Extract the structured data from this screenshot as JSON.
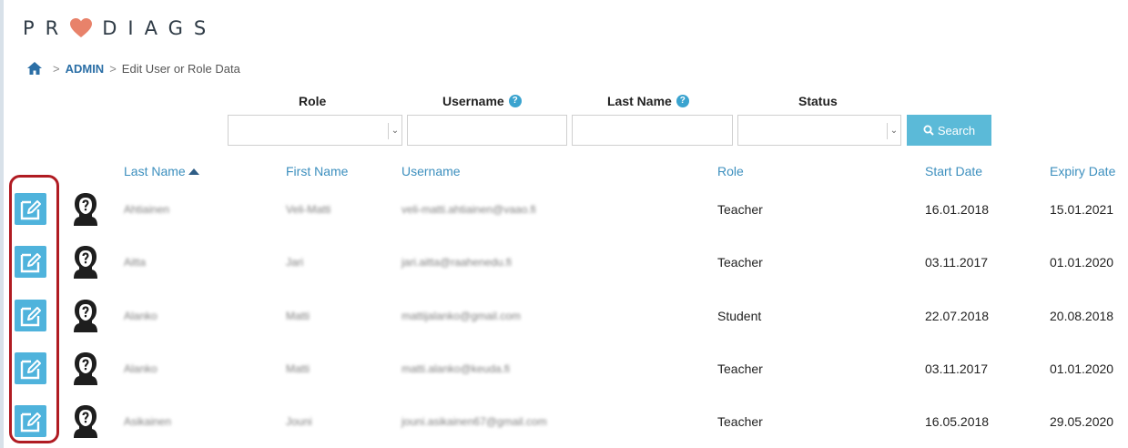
{
  "logo": {
    "text_a": "PR",
    "text_b": "DIAGS"
  },
  "breadcrumb": {
    "separator": ">",
    "admin": "ADMIN",
    "current": "Edit User or Role Data"
  },
  "filters": {
    "role_label": "Role",
    "username_label": "Username",
    "lastname_label": "Last Name",
    "status_label": "Status",
    "help_glyph": "?",
    "role_value": "",
    "username_value": "",
    "lastname_value": "",
    "status_value": "",
    "search_label": "Search"
  },
  "columns": {
    "last_name": "Last Name",
    "first_name": "First Name",
    "username": "Username",
    "role": "Role",
    "start_date": "Start Date",
    "expiry_date": "Expiry Date",
    "sorted_column": "last_name",
    "sort_direction": "ascending"
  },
  "rows": [
    {
      "last_name": "Ahtiainen",
      "first_name": "Veli-Matti",
      "username": "veli-matti.ahtiainen@vaao.fi",
      "role": "Teacher",
      "start_date": "16.01.2018",
      "expiry_date": "15.01.2021"
    },
    {
      "last_name": "Aitta",
      "first_name": "Jari",
      "username": "jari.aitta@raahenedu.fi",
      "role": "Teacher",
      "start_date": "03.11.2017",
      "expiry_date": "01.01.2020"
    },
    {
      "last_name": "Alanko",
      "first_name": "Matti",
      "username": "mattijalanko@gmail.com",
      "role": "Student",
      "start_date": "22.07.2018",
      "expiry_date": "20.08.2018"
    },
    {
      "last_name": "Alanko",
      "first_name": "Matti",
      "username": "matti.alanko@keuda.fi",
      "role": "Teacher",
      "start_date": "03.11.2017",
      "expiry_date": "01.01.2020"
    },
    {
      "last_name": "Asikainen",
      "first_name": "Jouni",
      "username": "jouni.asikainen67@gmail.com",
      "role": "Teacher",
      "start_date": "16.05.2018",
      "expiry_date": "29.05.2020"
    }
  ],
  "colors": {
    "accent": "#4fb3dc",
    "link": "#3c8fbe",
    "admin_link": "#2b6fa6",
    "logo_heart": "#e8826a",
    "highlight_ring": "#b01b22"
  },
  "icons": {
    "home": "home-icon",
    "help": "help-icon",
    "search": "search-icon",
    "edit": "edit-icon",
    "avatar": "unknown-user-avatar-icon",
    "dropdown": "chevron-down-icon",
    "sort": "sort-ascending-icon"
  }
}
